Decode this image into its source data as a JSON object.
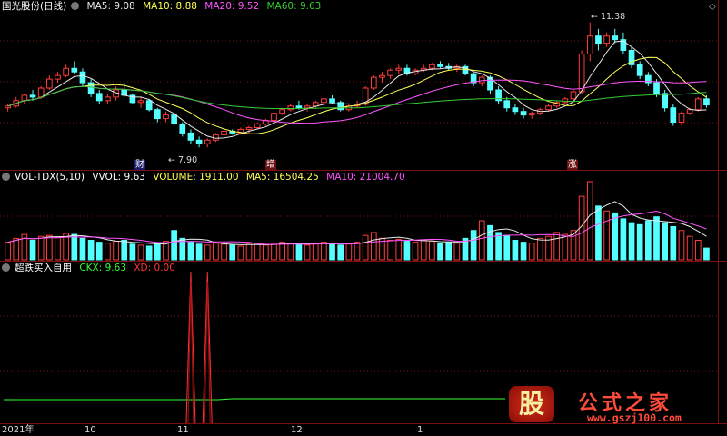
{
  "colors": {
    "up": "#ff3b3b",
    "down": "#54ffff",
    "ma5": "#e8e8e8",
    "ma10": "#ffff55",
    "ma20": "#ff55ff",
    "ma60": "#33cc33",
    "grid": "#7a1010",
    "ckx": "#33ff33",
    "xd": "#ff3333"
  },
  "panel1": {
    "title": "国光股份(日线)",
    "ma5_label": "MA5: 9.08",
    "ma10_label": "MA10: 8.88",
    "ma20_label": "MA20: 9.52",
    "ma60_label": "MA60: 9.63",
    "high_marker": "11.38",
    "low_marker": "7.90",
    "events": [
      "财",
      "增",
      "涨"
    ]
  },
  "panel2": {
    "title": "VOL-TDX(5,10)",
    "vvol_label": "VVOL: 9.63",
    "volume_label": "VOLUME: 1911.00",
    "ma5_label": "MA5: 16504.25",
    "ma10_label": "MA10: 21004.70"
  },
  "panel3": {
    "title": "超跌买入自用",
    "ckx_label": "CKX: 9.63",
    "xd_label": "XD: 0.00"
  },
  "xaxis": {
    "labels": [
      "2021年",
      "10",
      "11",
      "12",
      "1"
    ]
  },
  "watermark": {
    "logo_char": "股",
    "brand": "公式之家",
    "url": "www.gszj100.com"
  },
  "chart_data": {
    "type": "candlestick",
    "price_range": [
      7.5,
      11.6
    ],
    "candles": [
      [
        9.0,
        9.1,
        8.9,
        9.05
      ],
      [
        9.05,
        9.3,
        9.0,
        9.2
      ],
      [
        9.2,
        9.4,
        9.1,
        9.35
      ],
      [
        9.35,
        9.5,
        9.2,
        9.3
      ],
      [
        9.3,
        9.6,
        9.25,
        9.55
      ],
      [
        9.55,
        9.9,
        9.5,
        9.8
      ],
      [
        9.8,
        10.0,
        9.7,
        9.9
      ],
      [
        9.9,
        10.2,
        9.85,
        10.1
      ],
      [
        10.1,
        10.3,
        9.95,
        10.0
      ],
      [
        10.0,
        10.1,
        9.6,
        9.7
      ],
      [
        9.7,
        9.8,
        9.3,
        9.4
      ],
      [
        9.4,
        9.5,
        9.1,
        9.2
      ],
      [
        9.2,
        9.4,
        9.1,
        9.3
      ],
      [
        9.3,
        9.6,
        9.2,
        9.5
      ],
      [
        9.5,
        9.7,
        9.3,
        9.35
      ],
      [
        9.35,
        9.4,
        9.1,
        9.15
      ],
      [
        9.15,
        9.3,
        9.0,
        9.2
      ],
      [
        9.2,
        9.25,
        8.9,
        8.95
      ],
      [
        8.95,
        9.0,
        8.6,
        8.7
      ],
      [
        8.7,
        8.9,
        8.6,
        8.8
      ],
      [
        8.8,
        8.85,
        8.5,
        8.55
      ],
      [
        8.55,
        8.6,
        8.2,
        8.3
      ],
      [
        8.3,
        8.4,
        8.0,
        8.1
      ],
      [
        8.1,
        8.2,
        7.9,
        8.0
      ],
      [
        8.0,
        8.15,
        7.9,
        8.1
      ],
      [
        8.1,
        8.3,
        8.05,
        8.25
      ],
      [
        8.25,
        8.4,
        8.2,
        8.35
      ],
      [
        8.35,
        8.4,
        8.25,
        8.3
      ],
      [
        8.3,
        8.45,
        8.25,
        8.4
      ],
      [
        8.4,
        8.5,
        8.3,
        8.45
      ],
      [
        8.45,
        8.6,
        8.4,
        8.55
      ],
      [
        8.55,
        8.7,
        8.5,
        8.65
      ],
      [
        8.65,
        8.9,
        8.6,
        8.85
      ],
      [
        8.85,
        9.0,
        8.8,
        8.95
      ],
      [
        8.95,
        9.1,
        8.9,
        9.05
      ],
      [
        9.05,
        9.2,
        8.95,
        9.0
      ],
      [
        9.0,
        9.1,
        8.9,
        9.05
      ],
      [
        9.05,
        9.2,
        9.0,
        9.15
      ],
      [
        9.15,
        9.3,
        9.1,
        9.25
      ],
      [
        9.25,
        9.35,
        9.1,
        9.15
      ],
      [
        9.15,
        9.2,
        8.9,
        8.95
      ],
      [
        8.95,
        9.1,
        8.9,
        9.05
      ],
      [
        9.05,
        9.2,
        9.0,
        9.1
      ],
      [
        9.1,
        9.6,
        9.05,
        9.55
      ],
      [
        9.55,
        9.9,
        9.5,
        9.85
      ],
      [
        9.85,
        10.0,
        9.7,
        9.9
      ],
      [
        9.9,
        10.1,
        9.8,
        10.05
      ],
      [
        10.05,
        10.2,
        9.95,
        10.1
      ],
      [
        10.1,
        10.2,
        9.9,
        9.95
      ],
      [
        9.95,
        10.1,
        9.9,
        10.05
      ],
      [
        10.05,
        10.2,
        10.0,
        10.1
      ],
      [
        10.1,
        10.25,
        10.05,
        10.2
      ],
      [
        10.2,
        10.3,
        10.1,
        10.15
      ],
      [
        10.15,
        10.25,
        10.05,
        10.1
      ],
      [
        10.1,
        10.2,
        10.0,
        10.15
      ],
      [
        10.15,
        10.2,
        9.9,
        9.95
      ],
      [
        9.95,
        10.0,
        9.6,
        9.7
      ],
      [
        9.7,
        9.9,
        9.6,
        9.85
      ],
      [
        9.85,
        9.9,
        9.4,
        9.5
      ],
      [
        9.5,
        9.6,
        9.1,
        9.2
      ],
      [
        9.2,
        9.3,
        8.9,
        9.0
      ],
      [
        9.0,
        9.1,
        8.8,
        8.9
      ],
      [
        8.9,
        9.0,
        8.7,
        8.8
      ],
      [
        8.8,
        8.9,
        8.7,
        8.85
      ],
      [
        8.85,
        9.0,
        8.8,
        8.95
      ],
      [
        8.95,
        9.1,
        8.9,
        9.05
      ],
      [
        9.05,
        9.2,
        9.0,
        9.15
      ],
      [
        9.15,
        9.3,
        9.1,
        9.25
      ],
      [
        9.25,
        9.5,
        9.2,
        9.45
      ],
      [
        9.45,
        10.6,
        9.4,
        10.5
      ],
      [
        10.5,
        11.38,
        10.3,
        11.0
      ],
      [
        11.0,
        11.2,
        10.6,
        10.8
      ],
      [
        10.8,
        11.1,
        10.7,
        11.0
      ],
      [
        11.0,
        11.2,
        10.8,
        10.9
      ],
      [
        10.9,
        11.1,
        10.5,
        10.6
      ],
      [
        10.6,
        10.7,
        10.1,
        10.2
      ],
      [
        10.2,
        10.3,
        9.8,
        9.9
      ],
      [
        9.9,
        10.0,
        9.6,
        9.7
      ],
      [
        9.7,
        9.8,
        9.3,
        9.4
      ],
      [
        9.4,
        9.5,
        8.9,
        9.0
      ],
      [
        9.0,
        9.1,
        8.5,
        8.6
      ],
      [
        8.6,
        8.9,
        8.5,
        8.85
      ],
      [
        8.85,
        9.0,
        8.8,
        8.95
      ],
      [
        8.95,
        9.3,
        8.9,
        9.25
      ],
      [
        9.25,
        9.35,
        9.0,
        9.08
      ]
    ],
    "volumes": [
      18,
      22,
      26,
      20,
      24,
      25,
      23,
      27,
      26,
      22,
      20,
      18,
      17,
      19,
      20,
      16,
      15,
      14,
      17,
      19,
      30,
      22,
      18,
      16,
      15,
      17,
      16,
      15,
      14,
      16,
      17,
      15,
      16,
      18,
      17,
      16,
      15,
      17,
      18,
      16,
      15,
      16,
      18,
      25,
      28,
      22,
      20,
      21,
      19,
      18,
      20,
      19,
      17,
      18,
      17,
      22,
      30,
      40,
      35,
      28,
      25,
      20,
      18,
      17,
      22,
      24,
      28,
      26,
      30,
      65,
      80,
      55,
      50,
      48,
      42,
      38,
      36,
      40,
      44,
      38,
      34,
      30,
      24,
      20,
      12
    ],
    "xd_spikes": [
      {
        "index": 22,
        "value": 1
      },
      {
        "index": 24,
        "value": 1
      }
    ]
  }
}
